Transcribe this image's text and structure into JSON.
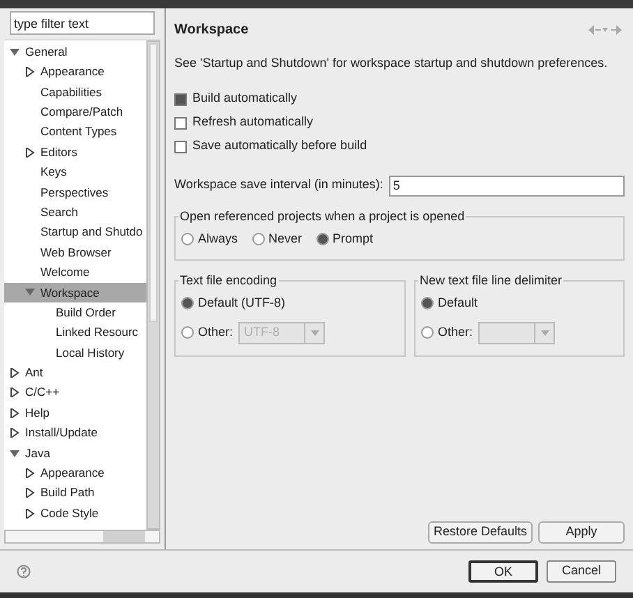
{
  "filter": {
    "value": "type filter text"
  },
  "tree": [
    {
      "label": "General",
      "expanded": true,
      "selected": false,
      "children": [
        {
          "label": "Appearance",
          "expanded": false,
          "selected": false
        },
        {
          "label": "Capabilities",
          "selected": false
        },
        {
          "label": "Compare/Patch",
          "selected": false
        },
        {
          "label": "Content Types",
          "selected": false
        },
        {
          "label": "Editors",
          "expanded": false,
          "selected": false
        },
        {
          "label": "Keys",
          "selected": false
        },
        {
          "label": "Perspectives",
          "selected": false
        },
        {
          "label": "Search",
          "selected": false
        },
        {
          "label": "Startup and Shutdo",
          "selected": false
        },
        {
          "label": "Web Browser",
          "selected": false
        },
        {
          "label": "Welcome",
          "selected": false
        },
        {
          "label": "Workspace",
          "expanded": true,
          "selected": true,
          "children": [
            {
              "label": "Build Order",
              "selected": false
            },
            {
              "label": "Linked Resourc",
              "selected": false
            },
            {
              "label": "Local History",
              "selected": false
            }
          ]
        }
      ]
    },
    {
      "label": "Ant",
      "expanded": false,
      "selected": false
    },
    {
      "label": "C/C++",
      "expanded": false,
      "selected": false
    },
    {
      "label": "Help",
      "expanded": false,
      "selected": false
    },
    {
      "label": "Install/Update",
      "expanded": false,
      "selected": false
    },
    {
      "label": "Java",
      "expanded": true,
      "selected": false,
      "children": [
        {
          "label": "Appearance",
          "expanded": false,
          "selected": false
        },
        {
          "label": "Build Path",
          "expanded": false,
          "selected": false
        },
        {
          "label": "Code Style",
          "expanded": false,
          "selected": false
        }
      ]
    }
  ],
  "page": {
    "title": "Workspace",
    "description": "See 'Startup and Shutdown' for workspace startup and shutdown preferences.",
    "checkboxes": [
      {
        "label": "Build automatically",
        "checked": true
      },
      {
        "label": "Refresh automatically",
        "checked": false
      },
      {
        "label": "Save automatically before build",
        "checked": false
      }
    ],
    "save_interval": {
      "label": "Workspace save interval (in minutes):",
      "value": "5"
    },
    "open_projects": {
      "title": "Open referenced projects when a project is opened",
      "options": [
        {
          "label": "Always",
          "selected": false
        },
        {
          "label": "Never",
          "selected": false
        },
        {
          "label": "Prompt",
          "selected": true
        }
      ]
    },
    "encoding": {
      "title": "Text file encoding",
      "options": [
        {
          "label": "Default (UTF-8)",
          "selected": true
        },
        {
          "label": "Other:",
          "selected": false
        }
      ],
      "combo": "UTF-8"
    },
    "delimiter": {
      "title": "New text file line delimiter",
      "options": [
        {
          "label": "Default",
          "selected": true
        },
        {
          "label": "Other:",
          "selected": false
        }
      ]
    },
    "buttons": [
      "Restore Defaults",
      "Apply"
    ]
  },
  "dialog_buttons": [
    "OK",
    "Cancel"
  ]
}
